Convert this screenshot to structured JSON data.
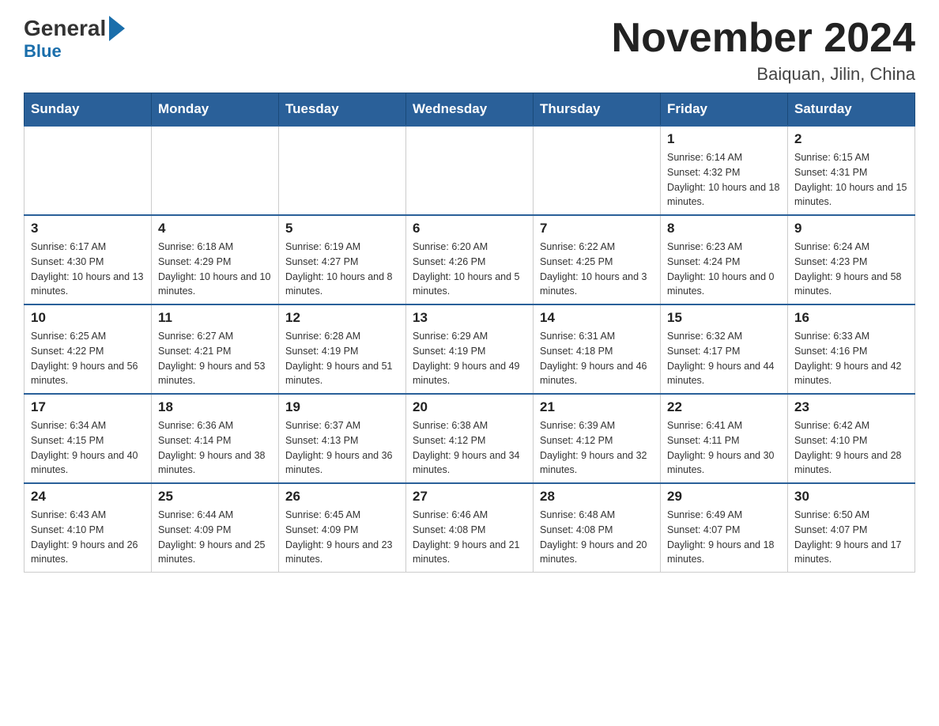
{
  "header": {
    "logo_general": "General",
    "logo_blue": "Blue",
    "month_title": "November 2024",
    "location": "Baiquan, Jilin, China"
  },
  "days_of_week": [
    "Sunday",
    "Monday",
    "Tuesday",
    "Wednesday",
    "Thursday",
    "Friday",
    "Saturday"
  ],
  "weeks": [
    {
      "days": [
        {
          "number": "",
          "info": ""
        },
        {
          "number": "",
          "info": ""
        },
        {
          "number": "",
          "info": ""
        },
        {
          "number": "",
          "info": ""
        },
        {
          "number": "",
          "info": ""
        },
        {
          "number": "1",
          "info": "Sunrise: 6:14 AM\nSunset: 4:32 PM\nDaylight: 10 hours and 18 minutes."
        },
        {
          "number": "2",
          "info": "Sunrise: 6:15 AM\nSunset: 4:31 PM\nDaylight: 10 hours and 15 minutes."
        }
      ]
    },
    {
      "days": [
        {
          "number": "3",
          "info": "Sunrise: 6:17 AM\nSunset: 4:30 PM\nDaylight: 10 hours and 13 minutes."
        },
        {
          "number": "4",
          "info": "Sunrise: 6:18 AM\nSunset: 4:29 PM\nDaylight: 10 hours and 10 minutes."
        },
        {
          "number": "5",
          "info": "Sunrise: 6:19 AM\nSunset: 4:27 PM\nDaylight: 10 hours and 8 minutes."
        },
        {
          "number": "6",
          "info": "Sunrise: 6:20 AM\nSunset: 4:26 PM\nDaylight: 10 hours and 5 minutes."
        },
        {
          "number": "7",
          "info": "Sunrise: 6:22 AM\nSunset: 4:25 PM\nDaylight: 10 hours and 3 minutes."
        },
        {
          "number": "8",
          "info": "Sunrise: 6:23 AM\nSunset: 4:24 PM\nDaylight: 10 hours and 0 minutes."
        },
        {
          "number": "9",
          "info": "Sunrise: 6:24 AM\nSunset: 4:23 PM\nDaylight: 9 hours and 58 minutes."
        }
      ]
    },
    {
      "days": [
        {
          "number": "10",
          "info": "Sunrise: 6:25 AM\nSunset: 4:22 PM\nDaylight: 9 hours and 56 minutes."
        },
        {
          "number": "11",
          "info": "Sunrise: 6:27 AM\nSunset: 4:21 PM\nDaylight: 9 hours and 53 minutes."
        },
        {
          "number": "12",
          "info": "Sunrise: 6:28 AM\nSunset: 4:19 PM\nDaylight: 9 hours and 51 minutes."
        },
        {
          "number": "13",
          "info": "Sunrise: 6:29 AM\nSunset: 4:19 PM\nDaylight: 9 hours and 49 minutes."
        },
        {
          "number": "14",
          "info": "Sunrise: 6:31 AM\nSunset: 4:18 PM\nDaylight: 9 hours and 46 minutes."
        },
        {
          "number": "15",
          "info": "Sunrise: 6:32 AM\nSunset: 4:17 PM\nDaylight: 9 hours and 44 minutes."
        },
        {
          "number": "16",
          "info": "Sunrise: 6:33 AM\nSunset: 4:16 PM\nDaylight: 9 hours and 42 minutes."
        }
      ]
    },
    {
      "days": [
        {
          "number": "17",
          "info": "Sunrise: 6:34 AM\nSunset: 4:15 PM\nDaylight: 9 hours and 40 minutes."
        },
        {
          "number": "18",
          "info": "Sunrise: 6:36 AM\nSunset: 4:14 PM\nDaylight: 9 hours and 38 minutes."
        },
        {
          "number": "19",
          "info": "Sunrise: 6:37 AM\nSunset: 4:13 PM\nDaylight: 9 hours and 36 minutes."
        },
        {
          "number": "20",
          "info": "Sunrise: 6:38 AM\nSunset: 4:12 PM\nDaylight: 9 hours and 34 minutes."
        },
        {
          "number": "21",
          "info": "Sunrise: 6:39 AM\nSunset: 4:12 PM\nDaylight: 9 hours and 32 minutes."
        },
        {
          "number": "22",
          "info": "Sunrise: 6:41 AM\nSunset: 4:11 PM\nDaylight: 9 hours and 30 minutes."
        },
        {
          "number": "23",
          "info": "Sunrise: 6:42 AM\nSunset: 4:10 PM\nDaylight: 9 hours and 28 minutes."
        }
      ]
    },
    {
      "days": [
        {
          "number": "24",
          "info": "Sunrise: 6:43 AM\nSunset: 4:10 PM\nDaylight: 9 hours and 26 minutes."
        },
        {
          "number": "25",
          "info": "Sunrise: 6:44 AM\nSunset: 4:09 PM\nDaylight: 9 hours and 25 minutes."
        },
        {
          "number": "26",
          "info": "Sunrise: 6:45 AM\nSunset: 4:09 PM\nDaylight: 9 hours and 23 minutes."
        },
        {
          "number": "27",
          "info": "Sunrise: 6:46 AM\nSunset: 4:08 PM\nDaylight: 9 hours and 21 minutes."
        },
        {
          "number": "28",
          "info": "Sunrise: 6:48 AM\nSunset: 4:08 PM\nDaylight: 9 hours and 20 minutes."
        },
        {
          "number": "29",
          "info": "Sunrise: 6:49 AM\nSunset: 4:07 PM\nDaylight: 9 hours and 18 minutes."
        },
        {
          "number": "30",
          "info": "Sunrise: 6:50 AM\nSunset: 4:07 PM\nDaylight: 9 hours and 17 minutes."
        }
      ]
    }
  ]
}
